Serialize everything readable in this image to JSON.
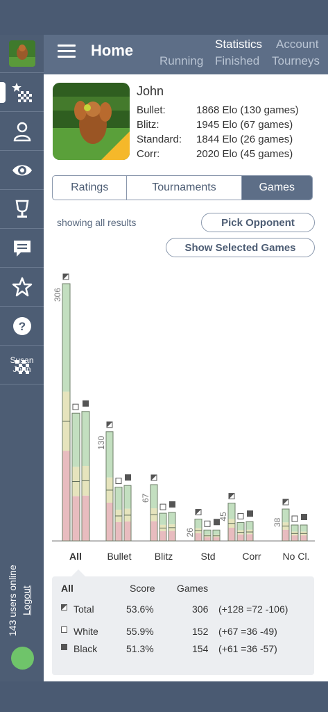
{
  "header": {
    "title": "Home",
    "nav": {
      "statistics": "Statistics",
      "account": "Account",
      "running": "Running",
      "finished": "Finished",
      "tourneys": "Tourneys"
    }
  },
  "sidebar": {
    "items": [
      {
        "icon": "profile-avatar"
      },
      {
        "icon": "board-star-icon"
      },
      {
        "icon": "people-icon"
      },
      {
        "icon": "eye-icon"
      },
      {
        "icon": "cup-icon"
      },
      {
        "icon": "message-icon"
      },
      {
        "icon": "star-icon"
      },
      {
        "icon": "help-icon"
      }
    ],
    "game": {
      "white": "Susan",
      "black": "John"
    },
    "online_text": "143 users online",
    "logout": "Logout",
    "status_color": "#6fc46a"
  },
  "profile": {
    "name": "John",
    "ratings": [
      {
        "label": "Bullet:",
        "value": "1868 Elo (130 games)"
      },
      {
        "label": "Blitz:",
        "value": "1945 Elo (67 games)"
      },
      {
        "label": "Standard:",
        "value": "1844 Elo (26 games)"
      },
      {
        "label": "Corr:",
        "value": "2020 Elo (45 games)"
      }
    ]
  },
  "tabs": {
    "ratings": "Ratings",
    "tournaments": "Tournaments",
    "games": "Games",
    "selected": "Games"
  },
  "filter": {
    "showing": "showing all results",
    "pick_opponent": "Pick Opponent",
    "show_selected": "Show Selected Games"
  },
  "chart_data": {
    "type": "bar",
    "categories": [
      "All",
      "Bullet",
      "Blitz",
      "Std",
      "Corr",
      "No Cl."
    ],
    "selected": "All",
    "totals": [
      306,
      130,
      67,
      26,
      45,
      38
    ],
    "colors": {
      "win": "#c3dfc0",
      "draw": "#e6e4bd",
      "loss": "#e8bcbf"
    },
    "series": [
      {
        "name": "Total",
        "values": [
          306,
          130,
          67,
          26,
          45,
          38
        ]
      },
      {
        "name": "White",
        "values": [
          152,
          64,
          33,
          13,
          22,
          19
        ]
      },
      {
        "name": "Black",
        "values": [
          154,
          66,
          34,
          13,
          23,
          19
        ]
      }
    ]
  },
  "summary": {
    "headers": {
      "category": "All",
      "score": "Score",
      "games": "Games"
    },
    "rows": [
      {
        "label": "Total",
        "score": "53.6%",
        "games": "306",
        "detail": "(+128 =72 -106)"
      },
      {
        "label": "White",
        "score": "55.9%",
        "games": "152",
        "detail": "(+67 =36 -49)"
      },
      {
        "label": "Black",
        "score": "51.3%",
        "games": "154",
        "detail": "(+61 =36 -57)"
      }
    ]
  }
}
